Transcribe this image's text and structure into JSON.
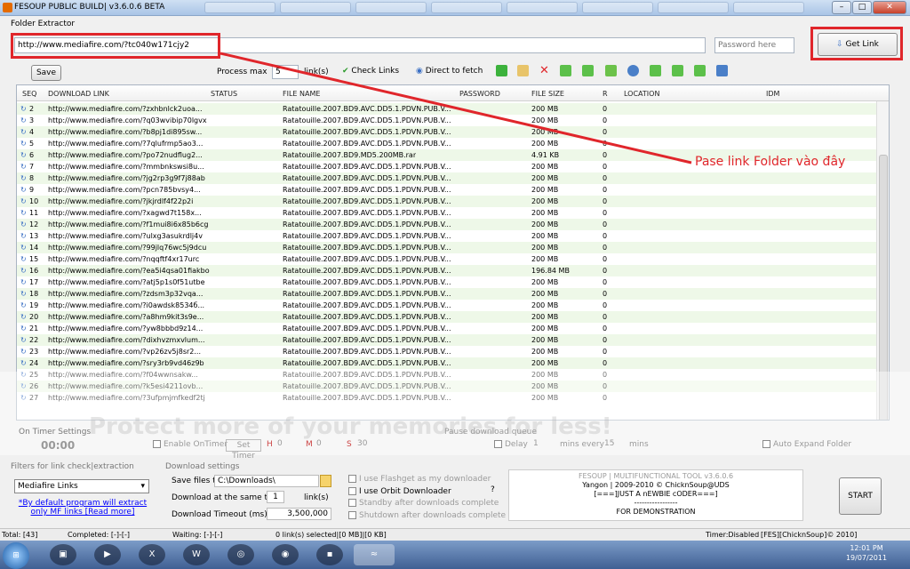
{
  "window": {
    "title": "FESOUP PUBLIC BUILD| v3.6.0.6 BETA",
    "min": "–",
    "max": "□",
    "close": "✕"
  },
  "extractor": {
    "label": "Folder Extractor",
    "url": "http://www.mediafire.com/?tc040w171cjy2",
    "password_placeholder": "Password here",
    "get_link": "Get Link"
  },
  "toolbar": {
    "save": "Save",
    "process_max": "Process max",
    "process_value": "5",
    "links": "link(s)",
    "check_links": "Check Links",
    "direct_fetch": "Direct to fetch"
  },
  "grid": {
    "columns": [
      "SEQ",
      "DOWNLOAD LINK",
      "STATUS",
      "FILE NAME",
      "PASSWORD",
      "FILE SIZE",
      "R",
      "LOCATION",
      "IDM"
    ],
    "rows": [
      {
        "seq": "2",
        "link": "http://www.mediafire.com/?zxhbnlck2uoa...",
        "file": "Ratatouille.2007.BD9.AVC.DD5.1.PDVN.PUB.V...",
        "size": "200 MB",
        "r": "0"
      },
      {
        "seq": "3",
        "link": "http://www.mediafire.com/?q03wvibip70lgvx",
        "file": "Ratatouille.2007.BD9.AVC.DD5.1.PDVN.PUB.V...",
        "size": "200 MB",
        "r": "0"
      },
      {
        "seq": "4",
        "link": "http://www.mediafire.com/?b8pj1di895sw...",
        "file": "Ratatouille.2007.BD9.AVC.DD5.1.PDVN.PUB.V...",
        "size": "200 MB",
        "r": "0"
      },
      {
        "seq": "5",
        "link": "http://www.mediafire.com/?7qlufrmp5ao3...",
        "file": "Ratatouille.2007.BD9.AVC.DD5.1.PDVN.PUB.V...",
        "size": "200 MB",
        "r": "0"
      },
      {
        "seq": "6",
        "link": "http://www.mediafire.com/?po72nudflug2...",
        "file": "Ratatouille.2007.BD9.MD5.200MB.rar",
        "size": "4.91 KB",
        "r": "0"
      },
      {
        "seq": "7",
        "link": "http://www.mediafire.com/?mmbnkswsi8u...",
        "file": "Ratatouille.2007.BD9.AVC.DD5.1.PDVN.PUB.V...",
        "size": "200 MB",
        "r": "0"
      },
      {
        "seq": "8",
        "link": "http://www.mediafire.com/?jg2rp3g9f7j88ab",
        "file": "Ratatouille.2007.BD9.AVC.DD5.1.PDVN.PUB.V...",
        "size": "200 MB",
        "r": "0"
      },
      {
        "seq": "9",
        "link": "http://www.mediafire.com/?pcn785bvsy4...",
        "file": "Ratatouille.2007.BD9.AVC.DD5.1.PDVN.PUB.V...",
        "size": "200 MB",
        "r": "0"
      },
      {
        "seq": "10",
        "link": "http://www.mediafire.com/?jkjrdlf4f22p2i",
        "file": "Ratatouille.2007.BD9.AVC.DD5.1.PDVN.PUB.V...",
        "size": "200 MB",
        "r": "0"
      },
      {
        "seq": "11",
        "link": "http://www.mediafire.com/?xagwd7t158x...",
        "file": "Ratatouille.2007.BD9.AVC.DD5.1.PDVN.PUB.V...",
        "size": "200 MB",
        "r": "0"
      },
      {
        "seq": "12",
        "link": "http://www.mediafire.com/?f1mui8i6x85b6cg",
        "file": "Ratatouille.2007.BD9.AVC.DD5.1.PDVN.PUB.V...",
        "size": "200 MB",
        "r": "0"
      },
      {
        "seq": "13",
        "link": "http://www.mediafire.com/?ulxg3asukrdlj4v",
        "file": "Ratatouille.2007.BD9.AVC.DD5.1.PDVN.PUB.V...",
        "size": "200 MB",
        "r": "0"
      },
      {
        "seq": "14",
        "link": "http://www.mediafire.com/?99jlq76wc5j9dcu",
        "file": "Ratatouille.2007.BD9.AVC.DD5.1.PDVN.PUB.V...",
        "size": "200 MB",
        "r": "0"
      },
      {
        "seq": "15",
        "link": "http://www.mediafire.com/?nqqftf4xr17urc",
        "file": "Ratatouille.2007.BD9.AVC.DD5.1.PDVN.PUB.V...",
        "size": "200 MB",
        "r": "0"
      },
      {
        "seq": "16",
        "link": "http://www.mediafire.com/?ea5i4qsa01fiakbo",
        "file": "Ratatouille.2007.BD9.AVC.DD5.1.PDVN.PUB.V...",
        "size": "196.84 MB",
        "r": "0"
      },
      {
        "seq": "17",
        "link": "http://www.mediafire.com/?atj5p1s0f51utbe",
        "file": "Ratatouille.2007.BD9.AVC.DD5.1.PDVN.PUB.V...",
        "size": "200 MB",
        "r": "0"
      },
      {
        "seq": "18",
        "link": "http://www.mediafire.com/?zdsm3p32vqa...",
        "file": "Ratatouille.2007.BD9.AVC.DD5.1.PDVN.PUB.V...",
        "size": "200 MB",
        "r": "0"
      },
      {
        "seq": "19",
        "link": "http://www.mediafire.com/?i0awdsk8534б...",
        "file": "Ratatouille.2007.BD9.AVC.DD5.1.PDVN.PUB.V...",
        "size": "200 MB",
        "r": "0"
      },
      {
        "seq": "20",
        "link": "http://www.mediafire.com/?a8hm9kit3s9e...",
        "file": "Ratatouille.2007.BD9.AVC.DD5.1.PDVN.PUB.V...",
        "size": "200 MB",
        "r": "0"
      },
      {
        "seq": "21",
        "link": "http://www.mediafire.com/?yw8bbbd9z14...",
        "file": "Ratatouille.2007.BD9.AVC.DD5.1.PDVN.PUB.V...",
        "size": "200 MB",
        "r": "0"
      },
      {
        "seq": "22",
        "link": "http://www.mediafire.com/?dixhvzmxvlum...",
        "file": "Ratatouille.2007.BD9.AVC.DD5.1.PDVN.PUB.V...",
        "size": "200 MB",
        "r": "0"
      },
      {
        "seq": "23",
        "link": "http://www.mediafire.com/?vp26zv5j8sr2...",
        "file": "Ratatouille.2007.BD9.AVC.DD5.1.PDVN.PUB.V...",
        "size": "200 MB",
        "r": "0"
      },
      {
        "seq": "24",
        "link": "http://www.mediafire.com/?sry3rb9vd46z9b",
        "file": "Ratatouille.2007.BD9.AVC.DD5.1.PDVN.PUB.V...",
        "size": "200 MB",
        "r": "0"
      },
      {
        "seq": "25",
        "link": "http://www.mediafire.com/?f04wwnsakw...",
        "file": "Ratatouille.2007.BD9.AVC.DD5.1.PDVN.PUB.V...",
        "size": "200 MB",
        "r": "0"
      },
      {
        "seq": "26",
        "link": "http://www.mediafire.com/?k5esi4211ovb...",
        "file": "Ratatouille.2007.BD9.AVC.DD5.1.PDVN.PUB.V...",
        "size": "200 MB",
        "r": "0"
      },
      {
        "seq": "27",
        "link": "http://www.mediafire.com/?3ufpmjmfkedf2tj",
        "file": "Ratatouille.2007.BD9.AVC.DD5.1.PDVN.PUB.V...",
        "size": "200 MB",
        "r": "0"
      }
    ]
  },
  "annotation": "Pase link Folder vào đây",
  "ontimer": {
    "label": "On Timer Settings",
    "value": "00:00",
    "enable": "Enable OnTimer",
    "set_timer": "Set Timer",
    "h": "H",
    "h_val": "0",
    "m": "M",
    "m_val": "0",
    "s": "S",
    "s_val": "30"
  },
  "pause": {
    "label": "Pause download queue",
    "delay": "Delay",
    "delay_val": "1",
    "mins_every": "mins every",
    "every_val": "15",
    "mins": "mins",
    "auto_expand": "Auto Expand Folder"
  },
  "filters": {
    "label": "Filters for link check|extraction",
    "selected": "Mediafire Links",
    "note": "*By default program will extract only MF links [Read more]"
  },
  "download": {
    "label": "Download settings",
    "save_files_to": "Save files to",
    "path": "C:\\Downloads\\",
    "same_time": "Download at the same time",
    "same_val": "1",
    "links": "link(s)",
    "timeout": "Download Timeout (ms)",
    "timeout_val": "3,500,000"
  },
  "options": [
    "I use Flashget as my downloader",
    "I use Orbit Downloader",
    "Standby after downloads complete",
    "Shutdown after downloads complete"
  ],
  "help": "?",
  "info": [
    "FESOUP | MULTIFUNCTIONAL TOOL v3.6.0.6",
    "Yangon | 2009-2010 © ChicknSoup@UDS",
    "[===]JUST A nEWBIE cODER===]",
    "-----------------",
    "FOR DEMONSTRATION"
  ],
  "start": "START",
  "watermark": "Protect more of your memories for less!",
  "status": {
    "total": "Total: [43]",
    "completed": "Completed: [-]-[-]",
    "waiting": "Waiting: [-]-[-]",
    "selected": "0 link(s) selected|[0 MB]|[0 KB]",
    "timer": "Timer:Disabled",
    "credit": "[FES][ChicknSoup]© 2010]"
  },
  "clock": {
    "time": "12:01 PM",
    "date": "19/07/2011"
  },
  "colors": {
    "accent": "#e0262b",
    "row_alt": "#eef8e8"
  }
}
